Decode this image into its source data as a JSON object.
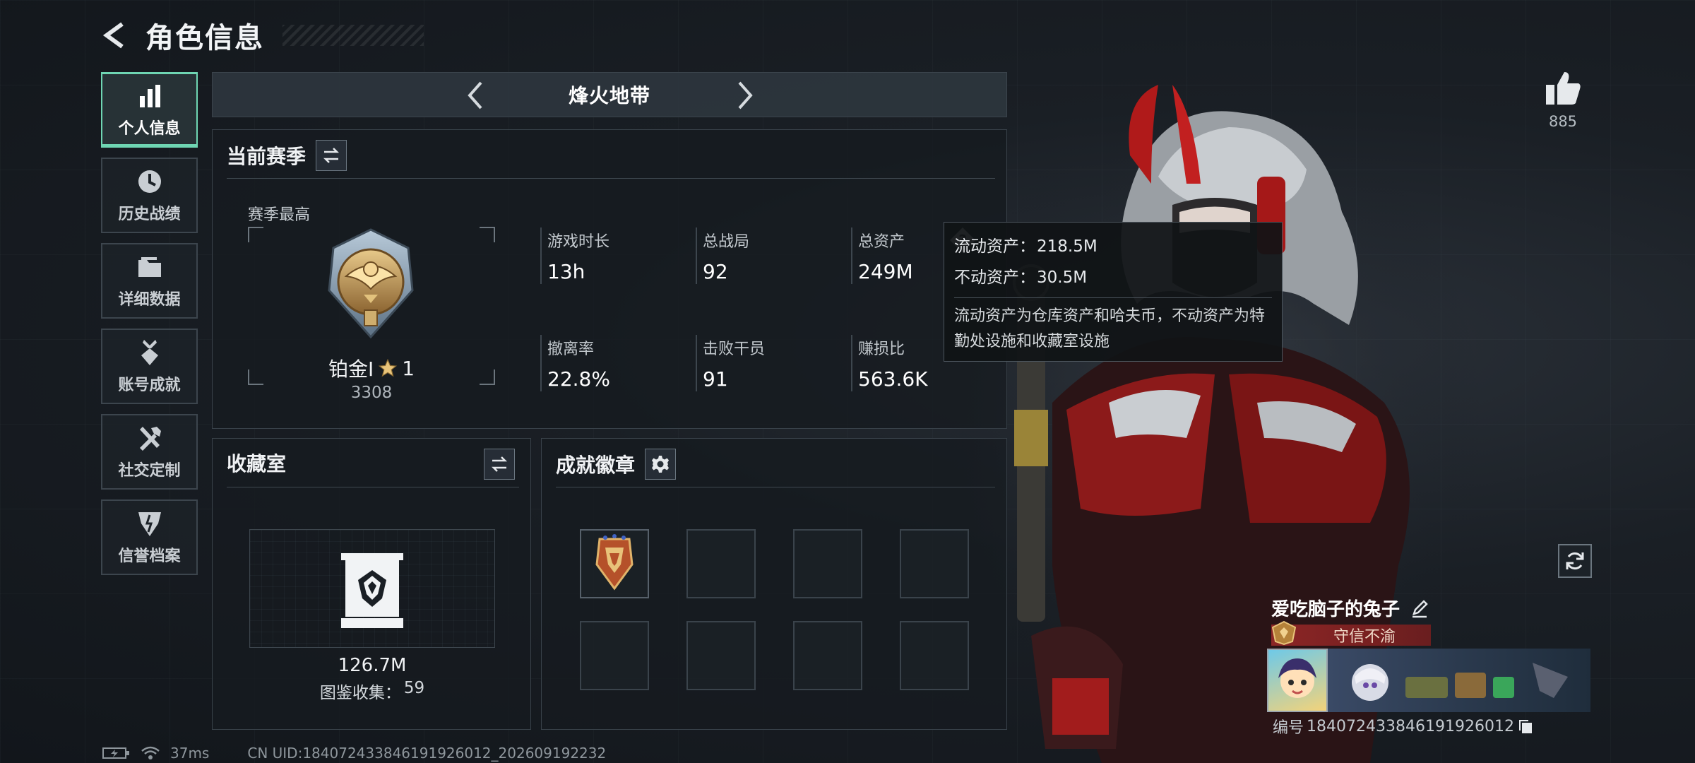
{
  "header": {
    "title": "角色信息"
  },
  "sidebar": {
    "items": [
      {
        "label": "个人信息",
        "icon": "bar-chart-icon",
        "active": true
      },
      {
        "label": "历史战绩",
        "icon": "history-clock-icon",
        "active": false
      },
      {
        "label": "详细数据",
        "icon": "folder-icon",
        "active": false
      },
      {
        "label": "账号成就",
        "icon": "achievement-medal-icon",
        "active": false
      },
      {
        "label": "社交定制",
        "icon": "tools-icon",
        "active": false
      },
      {
        "label": "信誉档案",
        "icon": "reputation-shield-icon",
        "active": false
      }
    ]
  },
  "mode": {
    "title": "烽火地带"
  },
  "season": {
    "title": "当前赛季",
    "best_label": "赛季最高",
    "rank_name": "铂金I",
    "rank_stars": "1",
    "rank_score": "3308",
    "stats": [
      {
        "label": "游戏时长",
        "value": "13h"
      },
      {
        "label": "总战局",
        "value": "92"
      },
      {
        "label": "总资产",
        "value": "249M"
      },
      {
        "label": "撤离率",
        "value": "22.8%"
      },
      {
        "label": "击败干员",
        "value": "91"
      },
      {
        "label": "赚损比",
        "value": "563.6K"
      }
    ]
  },
  "tooltip": {
    "liquid_label": "流动资产：",
    "liquid_value": "218.5M",
    "fixed_label": "不动资产：",
    "fixed_value": "30.5M",
    "description": "流动资产为仓库资产和哈夫币，不动资产为特勤处设施和收藏室设施"
  },
  "collection": {
    "title": "收藏室",
    "value": "126.7M",
    "count_label": "图鉴收集：",
    "count_value": "59"
  },
  "badges": {
    "title": "成就徽章",
    "slots_total": 8,
    "filled": 1
  },
  "profile": {
    "likes": "885",
    "player_name": "爱吃脑子的兔子",
    "trust_title": "守信不渝",
    "id_label": "编号",
    "id_value": "1840724338461919260​12"
  },
  "status": {
    "ping": "37ms",
    "uid": "CN UID:184072433846191926012_202609192232"
  },
  "colors": {
    "accent": "#6fd6b3",
    "trust_red": "#962828",
    "background": "#1a1f25"
  }
}
